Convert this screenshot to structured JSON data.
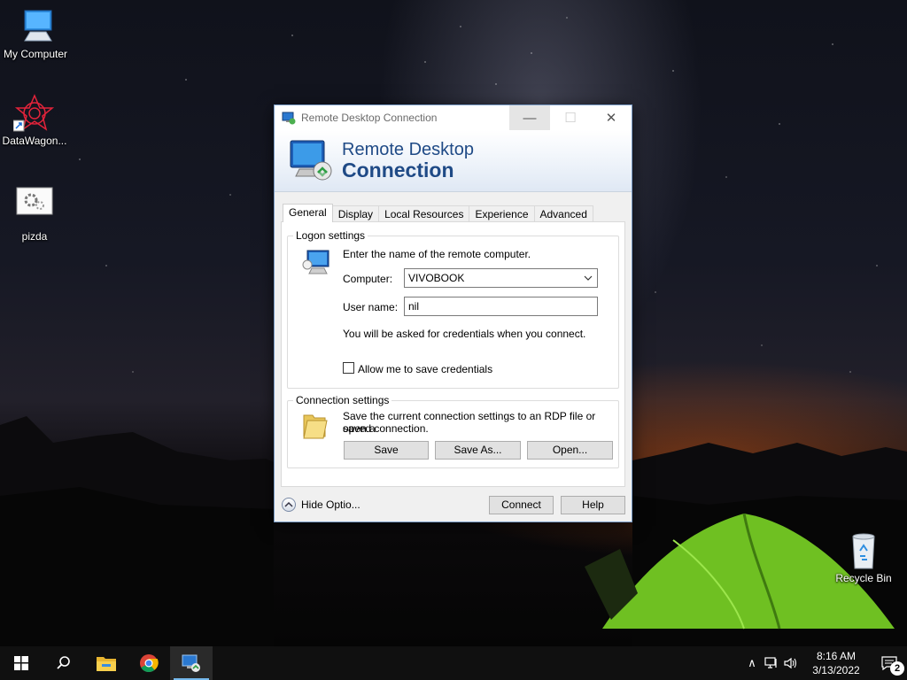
{
  "desktop": {
    "icons": [
      {
        "label": "My Computer",
        "icon": "computer-icon"
      },
      {
        "label": "DataWagon...",
        "icon": "datawagon-icon"
      },
      {
        "label": "pizda",
        "icon": "settings-file-icon"
      },
      {
        "label": "Recycle Bin",
        "icon": "recycle-bin-icon"
      }
    ]
  },
  "window": {
    "title": "Remote Desktop Connection",
    "controls": {
      "minimize": "—",
      "maximize": "☐",
      "close": "✕"
    },
    "banner": {
      "line1": "Remote Desktop",
      "line2": "Connection"
    },
    "tabs": [
      {
        "label": "General",
        "active": true
      },
      {
        "label": "Display"
      },
      {
        "label": "Local Resources"
      },
      {
        "label": "Experience"
      },
      {
        "label": "Advanced"
      }
    ],
    "logon": {
      "title": "Logon settings",
      "instruction": "Enter the name of the remote computer.",
      "computer_label": "Computer:",
      "computer_value": "VIVOBOOK",
      "username_label": "User name:",
      "username_value": "nil",
      "credentials_note": "You will be asked for credentials when you connect.",
      "save_credentials_label": "Allow me to save credentials",
      "save_credentials_checked": false
    },
    "connection": {
      "title": "Connection settings",
      "description_line1": "Save the current connection settings to an RDP file or open a",
      "description_line2": "saved connection.",
      "save": "Save",
      "save_as": "Save As...",
      "open": "Open..."
    },
    "footer": {
      "hide_options": "Hide Optio...",
      "connect": "Connect",
      "help": "Help"
    }
  },
  "taskbar": {
    "apps": [
      "windows-start-icon",
      "search-icon",
      "file-explorer-icon",
      "chrome-icon",
      "remote-desktop-icon"
    ],
    "clock": {
      "time": "8:16 AM",
      "date": "3/13/2022"
    },
    "tray": {
      "chevron": "∧",
      "notifications_count": "2"
    }
  },
  "colors": {
    "accent": "#1f4a86",
    "taskbar": "#101010",
    "tent": "#7bd12a"
  }
}
